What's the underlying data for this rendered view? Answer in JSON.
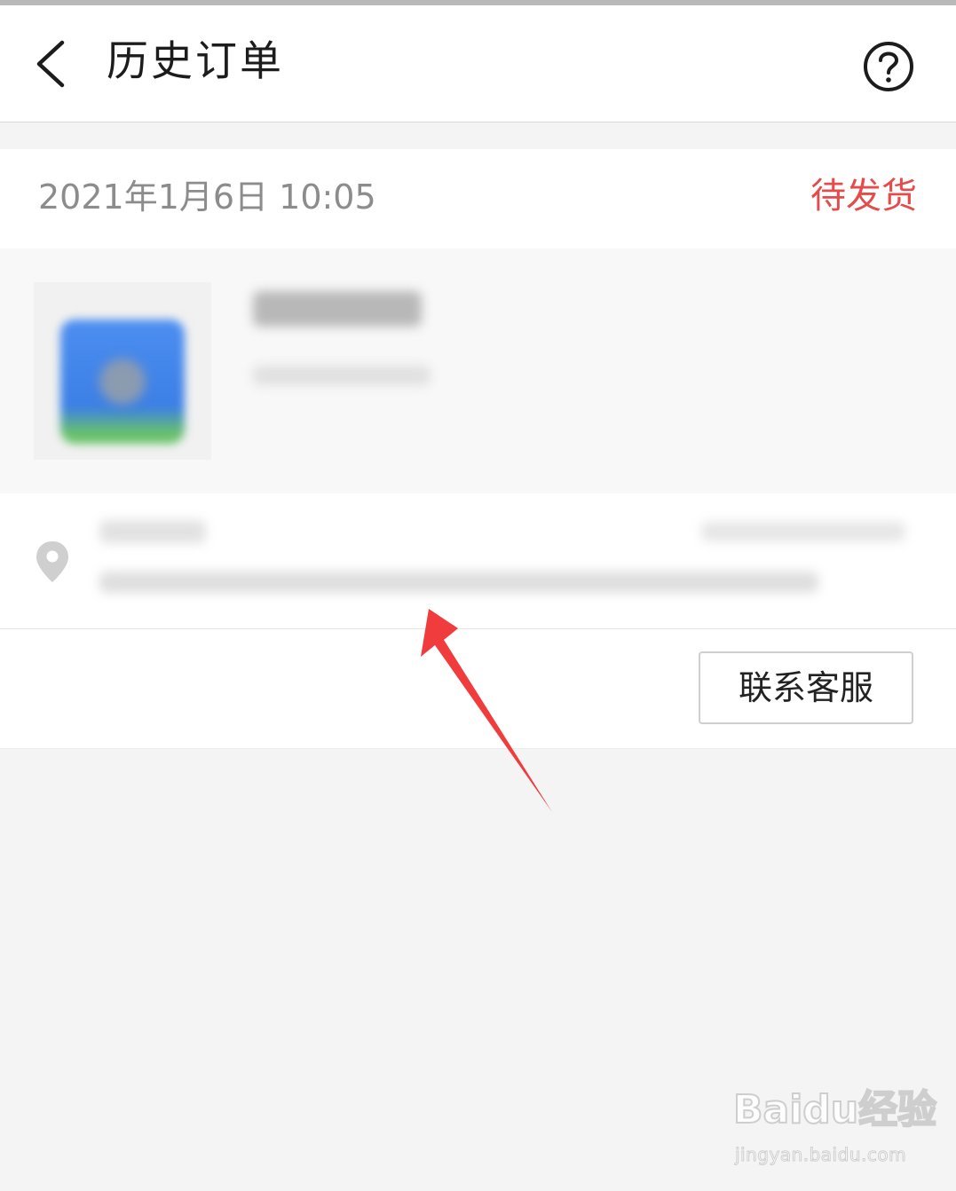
{
  "header": {
    "title": "历史订单",
    "back_icon": "chevron-left-icon",
    "help_icon": "question-circle-icon"
  },
  "order": {
    "time": "2021年1月6日 10:05",
    "status": "待发货",
    "status_color": "#e54b4b"
  },
  "actions": {
    "contact_label": "联系客服"
  },
  "watermark": {
    "logo": "Baidu经验",
    "url": "jingyan.baidu.com"
  }
}
